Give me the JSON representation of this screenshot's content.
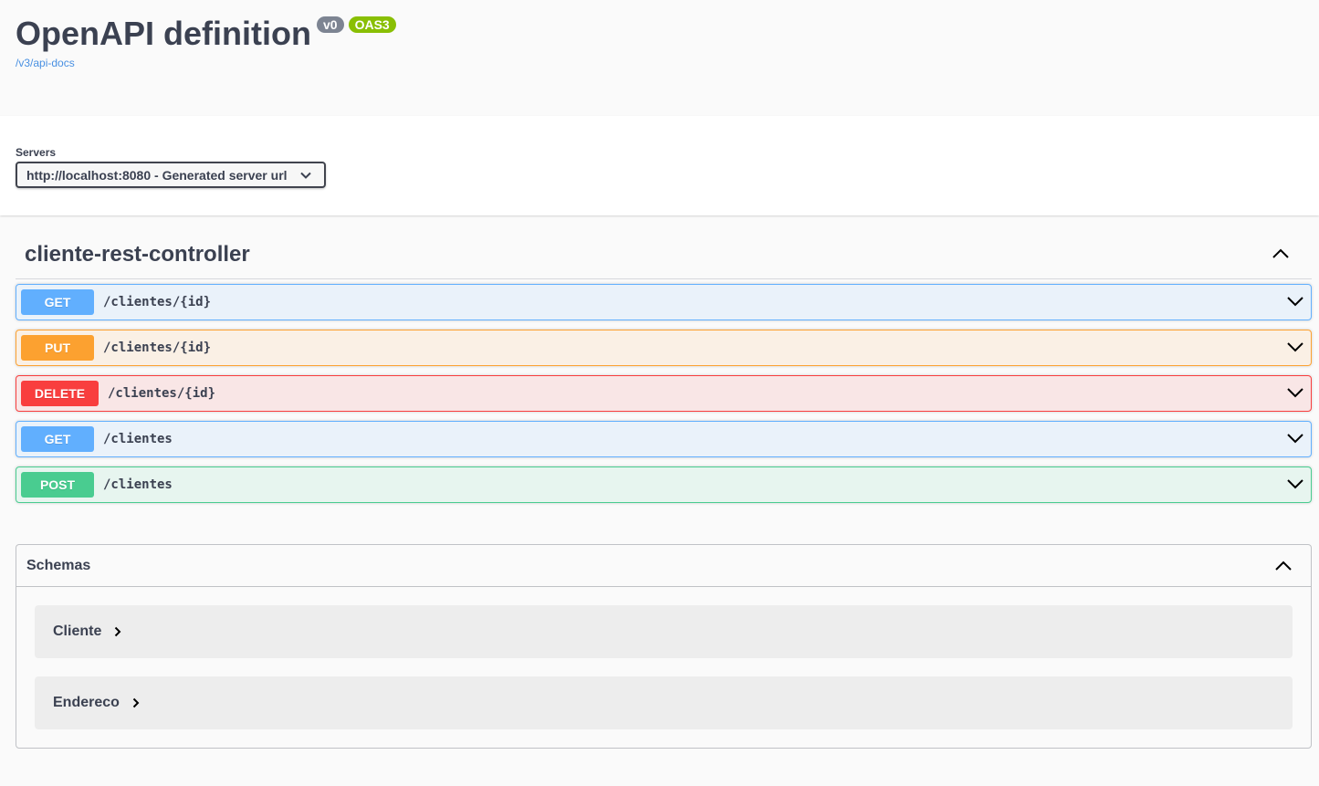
{
  "info": {
    "title": "OpenAPI definition",
    "version": "v0",
    "oas": "OAS3",
    "docs_link": "/v3/api-docs"
  },
  "servers": {
    "label": "Servers",
    "selected": "http://localhost:8080 - Generated server url"
  },
  "controller": {
    "name": "cliente-rest-controller",
    "operations": [
      {
        "method": "GET",
        "path": "/clientes/{id}"
      },
      {
        "method": "PUT",
        "path": "/clientes/{id}"
      },
      {
        "method": "DELETE",
        "path": "/clientes/{id}"
      },
      {
        "method": "GET",
        "path": "/clientes"
      },
      {
        "method": "POST",
        "path": "/clientes"
      }
    ]
  },
  "schemas": {
    "label": "Schemas",
    "models": [
      {
        "name": "Cliente"
      },
      {
        "name": "Endereco"
      }
    ]
  },
  "colors": {
    "get": "#61affe",
    "put": "#fca130",
    "delete": "#f93e3e",
    "post": "#49cc90",
    "version_badge": "#7d8492",
    "oas_badge": "#89bf04",
    "link": "#4990e2"
  }
}
